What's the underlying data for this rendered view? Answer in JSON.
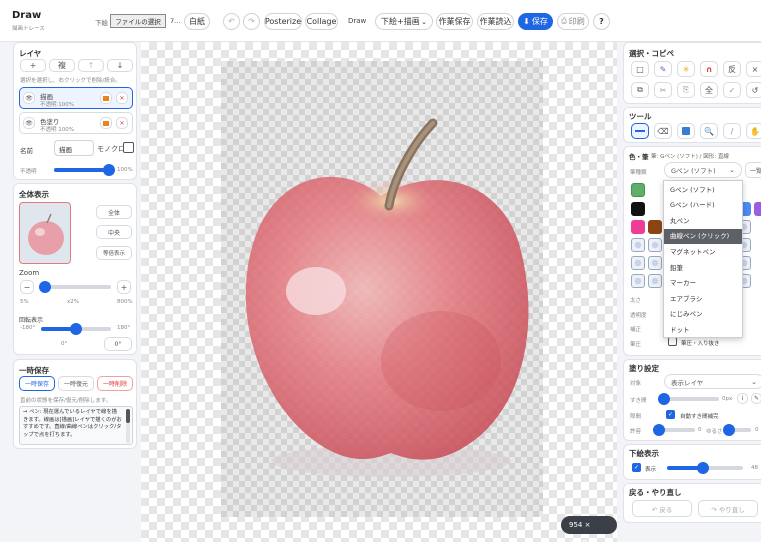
{
  "app": {
    "title": "Draw",
    "subtitle": "描画トレース"
  },
  "header": {
    "underlay_label": "下絵",
    "file_button": "ファイルの選択",
    "file_name": "7...",
    "clear_button": "白紙",
    "posterize_button": "Posterize",
    "collage_button": "Collage",
    "draw_label": "Draw",
    "mode_select": "下絵+描画",
    "save_work_button": "作業保存",
    "load_work_button": "作業読込",
    "save_button": "保存",
    "print_button": "印刷",
    "help_button": "?"
  },
  "layers": {
    "title": "レイヤ",
    "add_label": "+",
    "copy_label": "複",
    "up_label": "↑",
    "down_label": "↓",
    "hint": "選択を選択し、右クリックで削除/統合。",
    "items": [
      {
        "name": "描画",
        "sub": "不透明 100%"
      },
      {
        "name": "色塗り",
        "sub": "不透明 100%"
      }
    ],
    "name_label": "名前",
    "name_value": "描画",
    "mono_label": "モノクロ",
    "opacity_label": "不透明",
    "opacity_value": "100%",
    "opacity_level": 1.0
  },
  "overview": {
    "title": "全体表示",
    "fit_button": "全体",
    "center_button": "中央",
    "reset_button": "等倍表示",
    "zoom_label": "Zoom",
    "zoom_minus": "−",
    "zoom_plus": "+",
    "zoom_min": "5%",
    "zoom_mid": "x2%",
    "zoom_max": "800%",
    "zoom_level": 0.05,
    "rotate_label": "回転表示",
    "rot_min": "-180°",
    "rot_max": "180°",
    "rot_value": "0°",
    "rot_button": "0°",
    "rot_level": 0.5
  },
  "temp_save": {
    "title": "一時保存",
    "save_button": "一時保存",
    "restore_button": "一時復元",
    "delete_button": "一時削除",
    "hint": "直前の状態を保存/復元/削除します。",
    "note": "→ ペン: 現在選んでいるレイヤで線を描きます。線画は[描画]レイヤで描くのがおすすめです。直線/曲線ペンはクリック/タップで点を打ちます。"
  },
  "canvas": {
    "size_label": "954 × 1350"
  },
  "select_copy": {
    "title": "選択・コピペ",
    "row1": [
      "□",
      "✎",
      "✳",
      "∩",
      "反",
      "×"
    ],
    "row2": [
      "⧉",
      "✂",
      "⎘",
      "全",
      "✓",
      "↺"
    ]
  },
  "tools": {
    "title": "ツール"
  },
  "color_pen": {
    "title": "色・筆",
    "current": "筆: Gペン (ソフト) / 図形: 直線",
    "type_label": "筆種類",
    "type_value": "Gペン (ソフト)",
    "side_button": "一覧",
    "size_label": "太さ",
    "opacity_label": "透明度",
    "correct_label": "補正",
    "taper_label": "筆圧",
    "taper_check_label": "筆圧・入り抜き",
    "swatch_colors": [
      "#5fb067",
      "#8f6cf0",
      "#111111",
      "#4c8bf5",
      "#9b5de5",
      "#ee3d96",
      "#8b4513"
    ]
  },
  "pen_menu": {
    "options": [
      "Gペン (ソフト)",
      "Gペン (ハード)",
      "丸ペン",
      "曲線ペン (クリック)",
      "マグネットペン",
      "鉛筆",
      "マーカー",
      "エアブラシ",
      "にじみペン",
      "ドット"
    ],
    "selected": 3
  },
  "fill": {
    "title": "塗り設定",
    "target_label": "対象",
    "target_value": "表示レイヤ",
    "gap_label": "すき間",
    "gap_value": "0px",
    "gap_level": 0.0,
    "expand_label": "隙間",
    "expand_check": "自動すき間補完",
    "tol_label": "許容",
    "tol_value": "0",
    "smooth_label": "ゆるさ",
    "smooth_value": "0",
    "tol_level": 0.1,
    "smooth_level": 0.1
  },
  "underlay": {
    "title": "下絵表示",
    "show_label": "表示",
    "value": "48",
    "level": 0.48
  },
  "undo": {
    "title": "戻る・やり直し",
    "undo_button": "↶ 戻る",
    "redo_button": "↷ やり直し"
  },
  "colors": {
    "accent": "#1f66e5",
    "danger": "#e03131",
    "apple": "#d9545d",
    "menu_highlight": "#5d6166"
  }
}
